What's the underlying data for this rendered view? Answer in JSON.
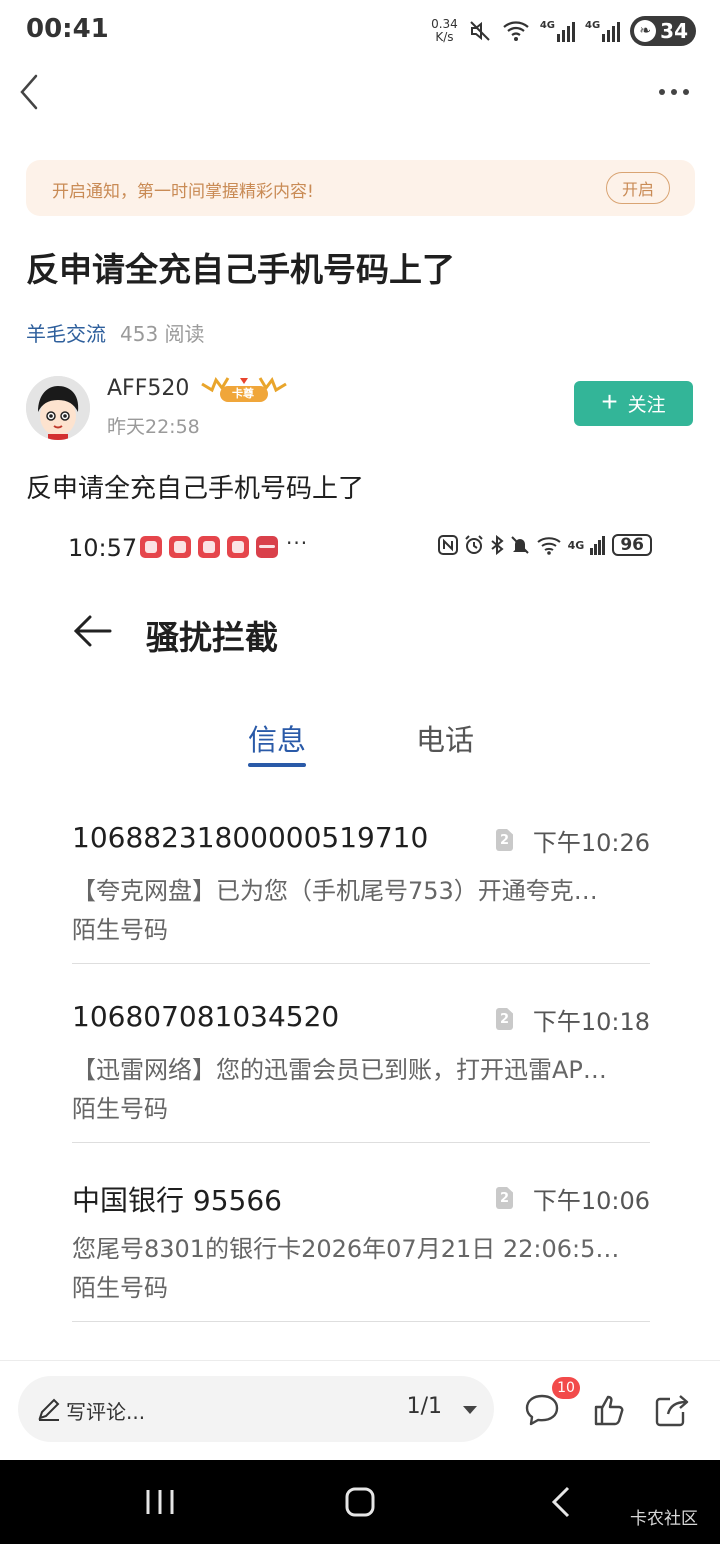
{
  "status_bar": {
    "time": "00:41",
    "net_speed_value": "0.34",
    "net_speed_unit": "K/s",
    "network_1": "4G",
    "network_2": "4G",
    "battery": "34"
  },
  "nav": {
    "back_icon": "chevron-left-icon",
    "more_icon": "more-dots-icon"
  },
  "notify": {
    "text": "开启通知，第一时间掌握精彩内容!",
    "button": "开启"
  },
  "post": {
    "title": "反申请全充自己手机号码上了",
    "category": "羊毛交流",
    "reads": "453 阅读",
    "body": "反申请全充自己手机号码上了"
  },
  "author": {
    "name": "AFF520",
    "badge_text": "卡尊",
    "time": "昨天22:58",
    "follow_label": "关注"
  },
  "embedded_screenshot": {
    "status_time": "10:57",
    "status_dots": "···",
    "battery": "96",
    "network": "4G",
    "page_title": "骚扰拦截",
    "tabs": [
      {
        "label": "信息",
        "active": true
      },
      {
        "label": "电话",
        "active": false
      }
    ],
    "sim_label": "2",
    "messages": [
      {
        "sender": "1068823180000051971​0",
        "time": "下午10:26",
        "preview": "【夸克网盘】已为您（手机尾号753）开通夸克…",
        "tag": "陌生号码"
      },
      {
        "sender": "106807081034520",
        "time": "下午10:18",
        "preview": "【迅雷网络】您的迅雷会员已到账，打开迅雷AP…",
        "tag": "陌生号码"
      },
      {
        "sender": "中国银行 95566",
        "time": "下午10:06",
        "preview": "您尾号8301的银行卡2026年07月21日  22:06:5…",
        "tag": "陌生号码"
      }
    ]
  },
  "comment_bar": {
    "placeholder": "写评论...",
    "page": "1/1",
    "comment_count": "10"
  },
  "watermark": "卡农社区",
  "colors": {
    "accent_green": "#33b598",
    "link_blue": "#2e5f9c",
    "tab_blue": "#2a5aa8",
    "notify_bg": "#fdf2e9",
    "notify_text": "#c98b55",
    "badge_red": "#f24a4a"
  }
}
